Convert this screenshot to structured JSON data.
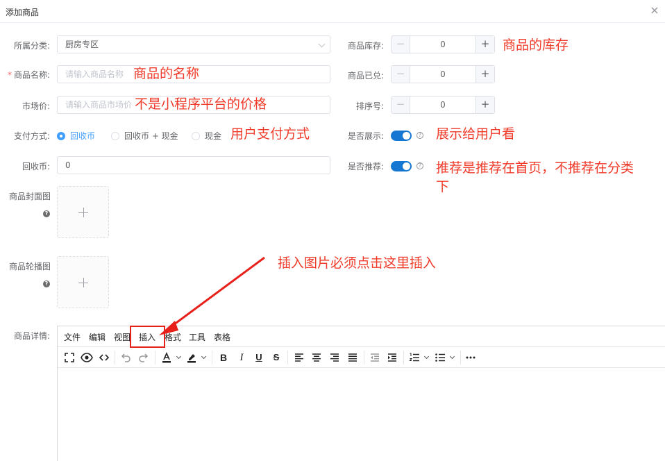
{
  "dialog": {
    "title": "添加商品",
    "close_icon": "close-icon"
  },
  "form": {
    "category": {
      "label": "所属分类:",
      "value": "厨房专区"
    },
    "name": {
      "required": "*",
      "label": "商品名称:",
      "placeholder": "请输入商品名称"
    },
    "market_price": {
      "label": "市场价:",
      "placeholder": "请输入商品市场价"
    },
    "payment": {
      "label": "支付方式:",
      "options": [
        "回收币",
        "回收币 + 现金",
        "现金"
      ],
      "selected": "回收币"
    },
    "coins": {
      "label": "回收币:",
      "value": "0"
    },
    "cover": {
      "label": "商品封面图"
    },
    "carousel": {
      "label": "商品轮播图"
    },
    "detail": {
      "label": "商品详情:"
    },
    "stock": {
      "label": "商品库存:",
      "value": "0"
    },
    "redeemed": {
      "label": "商品已兑:",
      "value": "0"
    },
    "sort": {
      "label": "排序号:",
      "value": "0"
    },
    "show": {
      "label": "是否展示:",
      "on": true
    },
    "recommend": {
      "label": "是否推荐:",
      "on": true
    }
  },
  "editor": {
    "menu": [
      "文件",
      "编辑",
      "视图",
      "插入",
      "格式",
      "工具",
      "表格"
    ],
    "toolbar_icons": [
      "fullscreen-icon",
      "preview-icon",
      "code-icon",
      "undo-icon",
      "redo-icon",
      "font-color-icon",
      "highlight-icon",
      "bold-icon",
      "italic-icon",
      "underline-icon",
      "strikethrough-icon",
      "align-left-icon",
      "align-center-icon",
      "align-right-icon",
      "align-justify-icon",
      "outdent-icon",
      "indent-icon",
      "ordered-list-icon",
      "bullet-list-icon",
      "more-icon"
    ]
  },
  "annotations": {
    "stock": "商品的库存",
    "name": "商品的名称",
    "market_price": "不是小程序平台的价格",
    "payment": "用户支付方式",
    "show": "展示给用户看",
    "recommend_line1": "推荐是推荐在首页，不推荐在分类",
    "recommend_line2": "下",
    "insert": "插入图片必须点击这里插入"
  },
  "colors": {
    "accent": "#409eff",
    "switch": "#1677d2",
    "annotation": "#f03b2a",
    "required": "#f56c6c"
  }
}
